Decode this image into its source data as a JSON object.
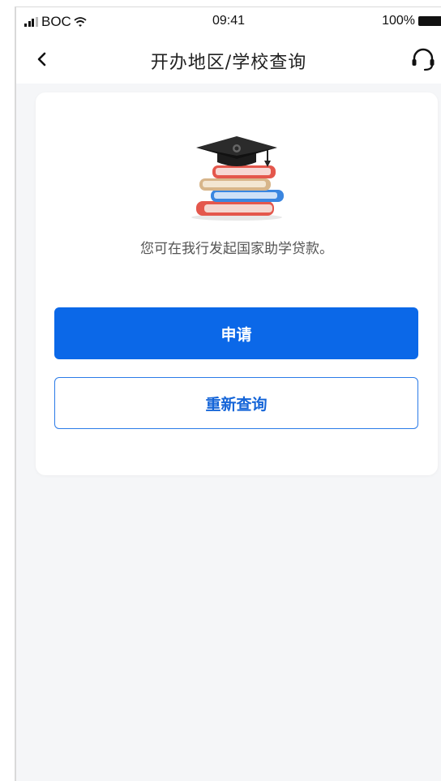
{
  "status_bar": {
    "carrier": "BOC",
    "time": "09:41",
    "battery": "100%"
  },
  "nav": {
    "back_icon": "chevron-left-icon",
    "title": "开办地区/学校查询",
    "service_icon": "headset-icon"
  },
  "card": {
    "illustration": "graduation-cap-books-icon",
    "message": "您可在我行发起国家助学贷款。",
    "apply_label": "申请",
    "requery_label": "重新查询"
  },
  "colors": {
    "primary": "#0b68e8",
    "background": "#f5f6f8",
    "card": "#ffffff"
  }
}
